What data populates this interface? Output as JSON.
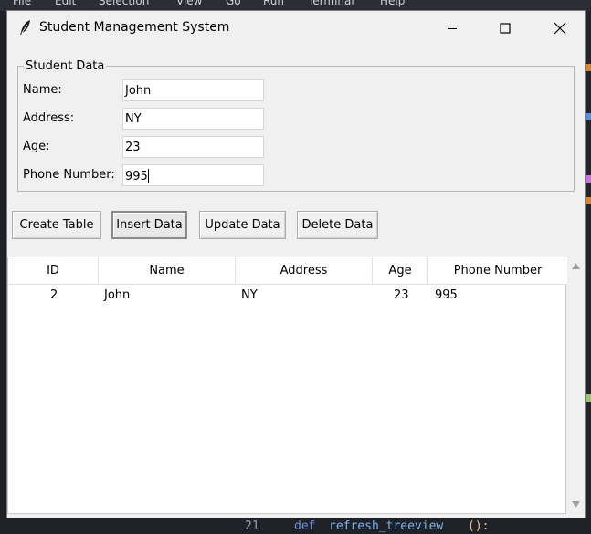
{
  "background_window": {
    "menu": [
      "File",
      "Edit",
      "Selection",
      "View",
      "Go",
      "Run",
      "Terminal",
      "Help"
    ],
    "code_line": {
      "number": "21",
      "keyword": "def",
      "name": "refresh_treeview",
      "parens": "():"
    }
  },
  "window": {
    "title": "Student Management System",
    "icon": "feather-icon",
    "controls": [
      "minimize-icon",
      "maximize-icon",
      "close-icon"
    ]
  },
  "form": {
    "group_label": "Student Data",
    "fields": [
      {
        "label": "Name:",
        "value": "John"
      },
      {
        "label": "Address:",
        "value": "NY"
      },
      {
        "label": "Age:",
        "value": "23"
      },
      {
        "label": "Phone Number:",
        "value": "995"
      }
    ]
  },
  "buttons": {
    "create": "Create Table",
    "insert": "Insert Data",
    "update": "Update Data",
    "delete": "Delete Data"
  },
  "table": {
    "columns": [
      "ID",
      "Name",
      "Address",
      "Age",
      "Phone Number"
    ],
    "rows": [
      [
        "2",
        "John",
        "NY",
        "23",
        "995"
      ]
    ]
  },
  "colors": {
    "window_bg": "#f0f0f0",
    "editor_bg": "#1f2128",
    "text": "#000000"
  }
}
